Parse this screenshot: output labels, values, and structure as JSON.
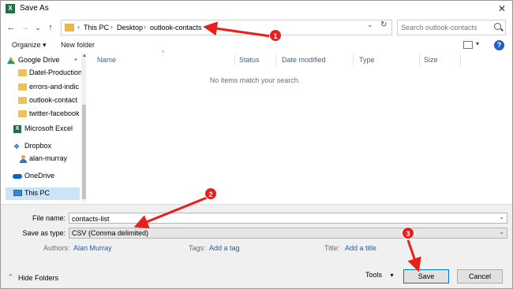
{
  "window": {
    "title": "Save As",
    "close_glyph": "✕",
    "app_icon": "X"
  },
  "nav": {
    "back": "←",
    "forward": "→",
    "recent": "⌄",
    "up": "↑",
    "breadcrumbs": [
      "This PC",
      "Desktop",
      "outlook-contacts"
    ],
    "crumb_sep": "›",
    "refresh": "↻",
    "chevron": "⌄"
  },
  "search": {
    "placeholder": "Search outlook-contacts"
  },
  "toolbar": {
    "organize": "Organize ▾",
    "new_folder": "New folder",
    "help": "?",
    "view_chev": "▾"
  },
  "sidebar": {
    "items": [
      {
        "label": "Google Drive",
        "icon": "google-drive-icon"
      },
      {
        "label": "Datel-Production",
        "icon": "folder-icon"
      },
      {
        "label": "errors-and-indic",
        "icon": "folder-icon"
      },
      {
        "label": "outlook-contact",
        "icon": "folder-icon"
      },
      {
        "label": "twitter-facebook",
        "icon": "folder-icon"
      },
      {
        "label": "Microsoft Excel",
        "icon": "excel-icon"
      },
      {
        "label": "Dropbox",
        "icon": "dropbox-icon"
      },
      {
        "label": "alan-murray",
        "icon": "user-icon"
      },
      {
        "label": "OneDrive",
        "icon": "onedrive-icon"
      },
      {
        "label": "This PC",
        "icon": "pc-icon",
        "selected": true
      }
    ]
  },
  "filelist": {
    "columns": [
      "Name",
      "Status",
      "Date modified",
      "Type",
      "Size"
    ],
    "empty_message": "No items match your search."
  },
  "form": {
    "file_name_label": "File name:",
    "file_name_value": "contacts-list",
    "save_type_label": "Save as type:",
    "save_type_value": "CSV (Comma delimited)",
    "authors_label": "Authors:",
    "authors_value": "Alan Murray",
    "tags_label": "Tags:",
    "tags_value": "Add a tag",
    "title_label": "Title:",
    "title_value": "Add a title"
  },
  "footer": {
    "hide_folders": "Hide Folders",
    "hide_chev": "⌃",
    "tools": "Tools",
    "tools_chev": "▾",
    "save": "Save",
    "cancel": "Cancel"
  },
  "annotations": {
    "badges": [
      "1",
      "2",
      "3"
    ],
    "color": "#e8201d"
  }
}
